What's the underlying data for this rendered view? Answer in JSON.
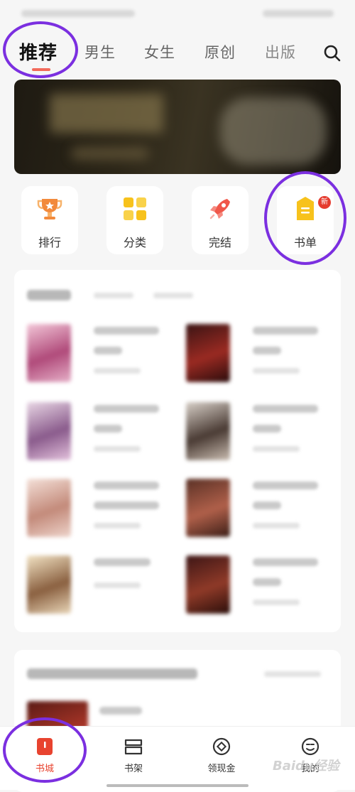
{
  "tabs": [
    {
      "label": "推荐",
      "active": true
    },
    {
      "label": "男生"
    },
    {
      "label": "女生"
    },
    {
      "label": "原创"
    },
    {
      "label": "出版"
    }
  ],
  "quick_actions": [
    {
      "label": "排行",
      "icon": "trophy-icon"
    },
    {
      "label": "分类",
      "icon": "grid-icon"
    },
    {
      "label": "完结",
      "icon": "rocket-icon"
    },
    {
      "label": "书单",
      "icon": "booklist-icon",
      "badge": "新"
    }
  ],
  "bottom_nav": [
    {
      "label": "书城",
      "icon": "bookstore-icon",
      "active": true
    },
    {
      "label": "书架",
      "icon": "bookshelf-icon"
    },
    {
      "label": "领现金",
      "icon": "coin-icon"
    },
    {
      "label": "我的",
      "icon": "profile-icon"
    }
  ],
  "watermark": "Baidu经验",
  "colors": {
    "accent": "#f26a5b",
    "highlight_circle": "#7b2fe0",
    "nav_active": "#e8432f"
  }
}
